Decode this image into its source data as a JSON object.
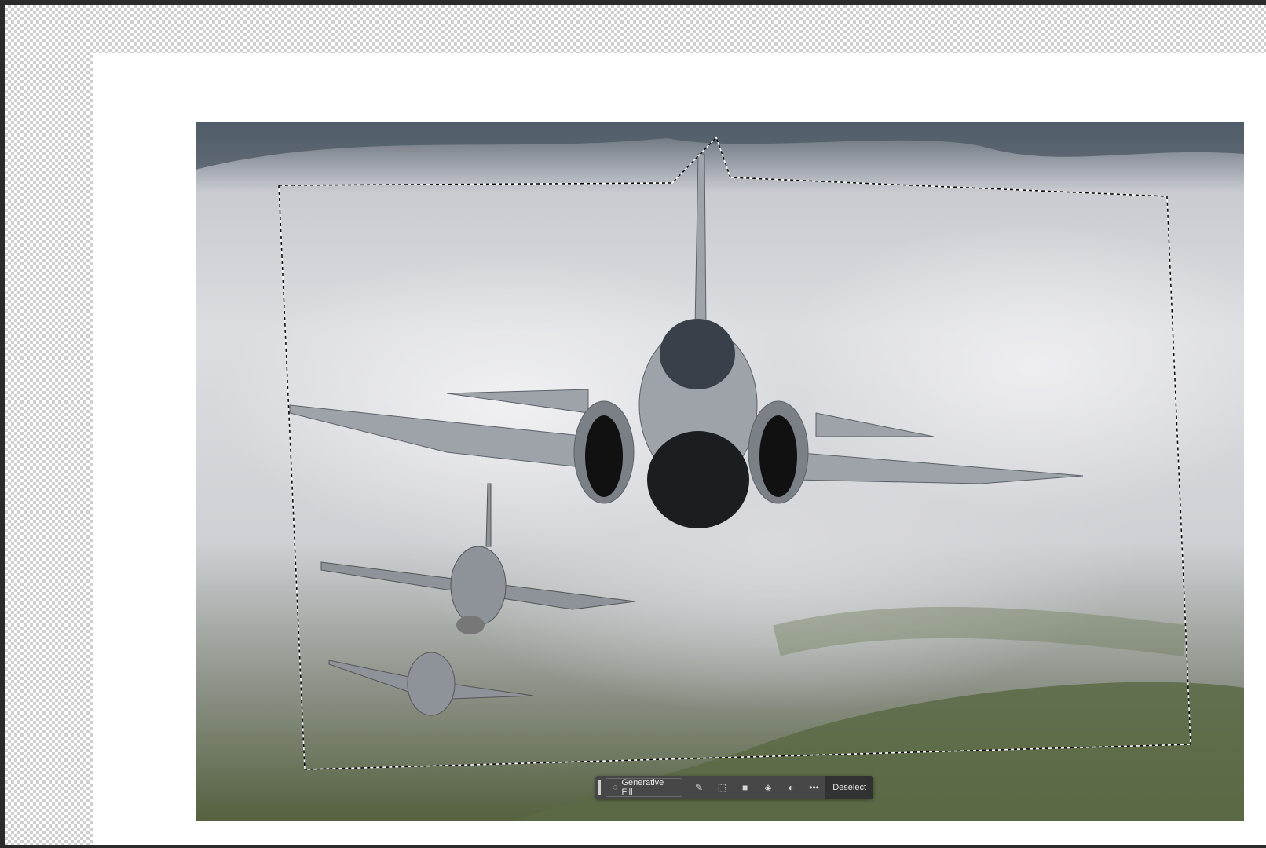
{
  "taskbar": {
    "generative_fill_label": "Generative Fill",
    "deselect_label": "Deselect",
    "icons": [
      "generative-sparkle-icon",
      "brush-refine-icon",
      "select-subject-icon",
      "mask-icon",
      "fill-bucket-icon",
      "adjustment-icon",
      "more-icon"
    ]
  }
}
